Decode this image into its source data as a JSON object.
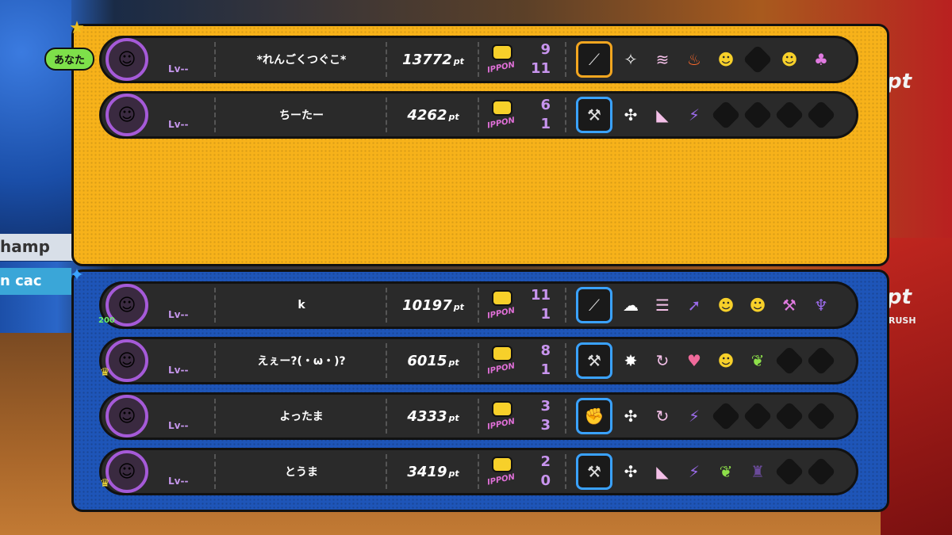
{
  "team_a": {
    "you_label": "あなた",
    "players": [
      {
        "name": "*れんごくつぐこ*",
        "level": "Lv--",
        "score": "13772",
        "pt": "pt",
        "ippon_label": "IPPON",
        "stat_top": "9",
        "stat_bot": "11",
        "power": "",
        "is_you": true
      },
      {
        "name": "ちーたー",
        "level": "Lv--",
        "score": "4262",
        "pt": "pt",
        "ippon_label": "IPPON",
        "stat_top": "6",
        "stat_bot": "1",
        "power": ""
      }
    ]
  },
  "team_b": {
    "players": [
      {
        "name": "k",
        "level": "Lv--",
        "score": "10197",
        "pt": "pt",
        "ippon_label": "IPPON",
        "stat_top": "11",
        "stat_bot": "1",
        "power": "200"
      },
      {
        "name": "えぇー?(・ω・)?",
        "level": "Lv--",
        "score": "6015",
        "pt": "pt",
        "ippon_label": "IPPON",
        "stat_top": "8",
        "stat_bot": "1",
        "power": ""
      },
      {
        "name": "よったま",
        "level": "Lv--",
        "score": "4333",
        "pt": "pt",
        "ippon_label": "IPPON",
        "stat_top": "3",
        "stat_bot": "3",
        "power": ""
      },
      {
        "name": "とうま",
        "level": "Lv--",
        "score": "3419",
        "pt": "pt",
        "ippon_label": "IPPON",
        "stat_top": "2",
        "stat_bot": "0",
        "power": ""
      }
    ]
  },
  "background": {
    "pt_text": "pt",
    "rush_text": "RUSH",
    "champ_text": "hamp",
    "cac_text": "n cac"
  },
  "colors": {
    "team_a": "#f7b21a",
    "team_b": "#1e55b8",
    "row_bg": "#2a2a2a",
    "ring": "#a55ad8"
  }
}
